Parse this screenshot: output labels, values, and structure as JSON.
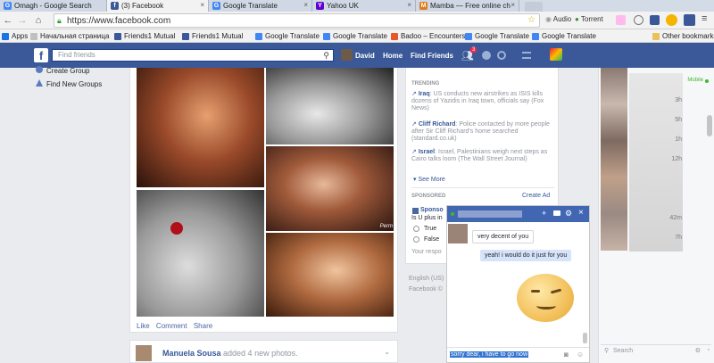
{
  "tabs": [
    {
      "title": "Omagh - Google Search",
      "fav": "G"
    },
    {
      "title": "(3) Facebook",
      "fav": "f"
    },
    {
      "title": "Google Translate",
      "fav": "G"
    },
    {
      "title": "Yahoo UK",
      "fav": "Y"
    },
    {
      "title": "Mamba — Free online ch",
      "fav": "M"
    }
  ],
  "toolbar": {
    "url": "https://www.facebook.com",
    "audio_label": "Audio",
    "torrent_label": "Torrent"
  },
  "bookmarks": {
    "apps_label": "Apps",
    "items": [
      "Начальная страница",
      "Friends1 Mutual",
      "Friends1 Mutual",
      "Google Translate",
      "Google Translate",
      "Badoo – Encounters",
      "Google Translate",
      "Google Translate"
    ],
    "other_label": "Other bookmarks"
  },
  "fbbar": {
    "logo": "f",
    "search_placeholder": "Find friends",
    "user_name": "David",
    "home_label": "Home",
    "find_friends_label": "Find Friends",
    "notif_count": "3"
  },
  "left": {
    "create_group": "Create Group",
    "find_groups": "Find New Groups"
  },
  "post": {
    "overlay_text": "Perm",
    "actions": [
      "Like",
      "Comment",
      "Share"
    ],
    "next_author": "Manuela Sousa",
    "next_text": " added 4 new photos."
  },
  "trending": {
    "heading": "TRENDING",
    "items": [
      {
        "topic": "Iraq",
        "text": ": US conducts new airstrikes as ISIS kills dozens of Yazidis in Iraq town, officials say (Fox News)"
      },
      {
        "topic": "Cliff Richard",
        "text": ": Police contacted by more people after Sir Cliff Richard's home searched (standard.co.uk)"
      },
      {
        "topic": "Israel",
        "text": ": Israel, Palestinians weigh next steps as Cairo talks loom (The Wall Street Journal)"
      }
    ],
    "see_more": "See More",
    "sponsored": "SPONSORED",
    "create_ad": "Create Ad",
    "sponsor_title": "Sponso",
    "sponsor_question": "Is U plus in",
    "opt_true": "True",
    "opt_false": "False",
    "respond": "Your respo",
    "footer1": "English (US)",
    "footer2": "Facebook ©"
  },
  "ticker": {
    "mobile_label": "Mobile",
    "ages": [
      "3h",
      "5h",
      "1h",
      "12h",
      "",
      "",
      "42m",
      "7h"
    ],
    "search_placeholder": "Search"
  },
  "chat": {
    "msg_in": "very decent of you",
    "msg_out": "yeah! i would do it just for you",
    "input_text": "sorry dear, i have to go now"
  },
  "colors": {
    "fb_blue": "#3b5998",
    "chat_blue": "#4267b2",
    "link": "#365899"
  }
}
